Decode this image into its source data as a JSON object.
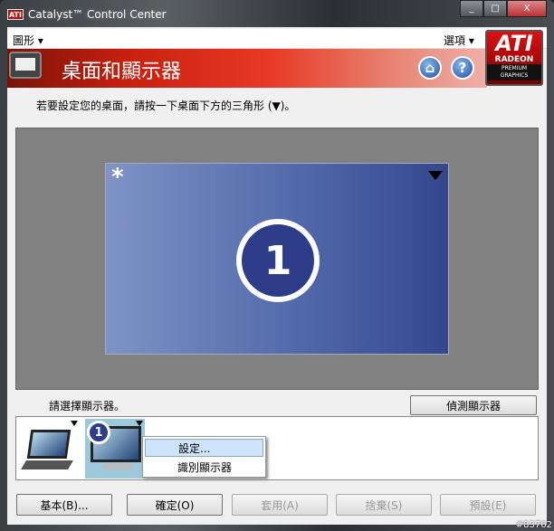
{
  "window": {
    "title": "Catalyst™ Control Center",
    "app_icon": "ATI",
    "minimize": "_",
    "maximize": "□",
    "close": "X"
  },
  "menu": {
    "graphics": "圖形 ▾",
    "options": "選項 ▾"
  },
  "header": {
    "title": "桌面和顯示器",
    "home": "⌂",
    "help": "?"
  },
  "logo": {
    "brand": "ATI",
    "line": "RADEON",
    "tag1": "PREMIUM",
    "tag2": "GRAPHICS"
  },
  "instruction": "若要設定您的桌面，請按一下桌面下方的三角形 (▼)。",
  "desktop": {
    "primary_marker": "*",
    "display_number": "1"
  },
  "select_label": "請選擇顯示器。",
  "detect_button": "偵測顯示器",
  "devices": [
    {
      "type": "laptop"
    },
    {
      "type": "monitor",
      "number": "1"
    }
  ],
  "context_menu": [
    "設定...",
    "識別顯示器"
  ],
  "buttons": {
    "basic": "基本(B)...",
    "ok": "確定(O)",
    "apply": "套用(A)",
    "discard": "捨棄(S)",
    "defaults": "預設(E)"
  },
  "watermark": "#83762"
}
